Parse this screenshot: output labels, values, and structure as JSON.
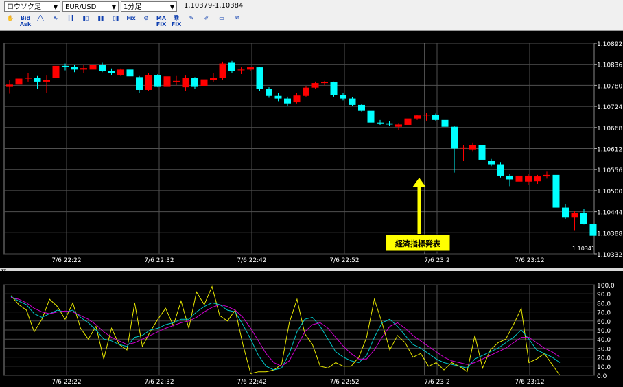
{
  "toolbar": {
    "chart_type": "ロウソク足",
    "pair": "EUR/USD",
    "timeframe": "1分足",
    "quote": "1.10379-1.10384",
    "icons": [
      {
        "name": "hand-icon",
        "glyph": "✋"
      },
      {
        "name": "bid-ask-icon",
        "glyph": "Bid Ask"
      },
      {
        "name": "line-chart-icon",
        "glyph": "╱╲"
      },
      {
        "name": "wave-chart-icon",
        "glyph": "∿"
      },
      {
        "name": "bar-chart-icon",
        "glyph": "┃┃"
      },
      {
        "name": "candlestick-icon",
        "glyph": "▮▯"
      },
      {
        "name": "candle-color-icon",
        "glyph": "▮▮"
      },
      {
        "name": "candle-alt-icon",
        "glyph": "▯▮"
      },
      {
        "name": "fix-icon",
        "glyph": "Fix"
      },
      {
        "name": "settings-fix-icon",
        "glyph": "⚙"
      },
      {
        "name": "ma-fix-icon",
        "glyph": "MA FIX"
      },
      {
        "name": "stochastic-fix-icon",
        "glyph": "乖 FIX"
      },
      {
        "name": "draw-line-icon",
        "glyph": "✎"
      },
      {
        "name": "erase-icon",
        "glyph": "✐"
      },
      {
        "name": "print-icon",
        "glyph": "▭"
      },
      {
        "name": "note-icon",
        "glyph": "✉"
      }
    ]
  },
  "chart_data": [
    {
      "type": "candlestick",
      "price_labels": [
        "1.10892",
        "1.10836",
        "1.10780",
        "1.10724",
        "1.10668",
        "1.10612",
        "1.10556",
        "1.10500",
        "1.10444",
        "1.10388",
        "1.10332"
      ],
      "current_price": "1.10341",
      "time_labels": [
        "7/6 22:22",
        "7/6 22:32",
        "7/6 22:42",
        "7/6 22:52",
        "7/6 23:2",
        "7/6 23:12"
      ],
      "ylim": [
        1.10332,
        1.10892
      ],
      "annotation": "経済指標発表",
      "colors": {
        "up": "#ff0000",
        "down": "#00ffff"
      },
      "candles": [
        [
          1.10776,
          1.10795,
          1.10758,
          1.10782
        ],
        [
          1.10782,
          1.10805,
          1.10772,
          1.10798
        ],
        [
          1.10798,
          1.10812,
          1.1079,
          1.108
        ],
        [
          1.108,
          1.10805,
          1.1077,
          1.1079
        ],
        [
          1.1079,
          1.10806,
          1.1076,
          1.10795
        ],
        [
          1.108,
          1.1084,
          1.10798,
          1.10832
        ],
        [
          1.10832,
          1.10838,
          1.1082,
          1.1083
        ],
        [
          1.1083,
          1.10835,
          1.10815,
          1.10822
        ],
        [
          1.10822,
          1.10835,
          1.10812,
          1.10826
        ],
        [
          1.10822,
          1.1084,
          1.1081,
          1.10835
        ],
        [
          1.10835,
          1.1084,
          1.10815,
          1.10818
        ],
        [
          1.10818,
          1.10825,
          1.10808,
          1.10812
        ],
        [
          1.10808,
          1.10825,
          1.10805,
          1.10822
        ],
        [
          1.10822,
          1.10825,
          1.108,
          1.10804
        ],
        [
          1.10802,
          1.10805,
          1.1076,
          1.10768
        ],
        [
          1.10768,
          1.10812,
          1.10766,
          1.10808
        ],
        [
          1.10808,
          1.1081,
          1.10775,
          1.10776
        ],
        [
          1.10776,
          1.10808,
          1.1077,
          1.10804
        ],
        [
          1.1079,
          1.10805,
          1.1078,
          1.10792
        ],
        [
          1.10775,
          1.10806,
          1.10765,
          1.108
        ],
        [
          1.108,
          1.10802,
          1.1077,
          1.10776
        ],
        [
          1.10778,
          1.108,
          1.10775,
          1.10796
        ],
        [
          1.10795,
          1.10812,
          1.1079,
          1.108
        ],
        [
          1.108,
          1.10843,
          1.10795,
          1.10838
        ],
        [
          1.1084,
          1.10845,
          1.10812,
          1.10818
        ],
        [
          1.1082,
          1.10828,
          1.1081,
          1.10822
        ],
        [
          1.10822,
          1.10828,
          1.10818,
          1.10828
        ],
        [
          1.10828,
          1.1083,
          1.10765,
          1.1077
        ],
        [
          1.1077,
          1.10775,
          1.10747,
          1.10752
        ],
        [
          1.10752,
          1.1076,
          1.10738,
          1.10745
        ],
        [
          1.10745,
          1.1075,
          1.10725,
          1.10732
        ],
        [
          1.10735,
          1.1076,
          1.10732,
          1.10753
        ],
        [
          1.10752,
          1.10778,
          1.1075,
          1.10774
        ],
        [
          1.10774,
          1.1079,
          1.1077,
          1.10786
        ],
        [
          1.10786,
          1.10792,
          1.1078,
          1.10788
        ],
        [
          1.10788,
          1.1079,
          1.1075,
          1.10755
        ],
        [
          1.10755,
          1.1076,
          1.1074,
          1.10745
        ],
        [
          1.10745,
          1.10748,
          1.10725,
          1.10728
        ],
        [
          1.10728,
          1.1073,
          1.1071,
          1.10712
        ],
        [
          1.10712,
          1.10715,
          1.10678,
          1.10681
        ],
        [
          1.10681,
          1.10688,
          1.10675,
          1.10679
        ],
        [
          1.10679,
          1.10684,
          1.10672,
          1.10676
        ],
        [
          1.1067,
          1.1068,
          1.10662,
          1.10676
        ],
        [
          1.10675,
          1.10695,
          1.10672,
          1.10692
        ],
        [
          1.10692,
          1.10702,
          1.10688,
          1.107
        ],
        [
          1.107,
          1.10706,
          1.10686,
          1.10702
        ],
        [
          1.10702,
          1.10705,
          1.10686,
          1.10688
        ],
        [
          1.10688,
          1.10692,
          1.10668,
          1.1067
        ],
        [
          1.1067,
          1.10672,
          1.10548,
          1.10612
        ],
        [
          1.10612,
          1.10622,
          1.1058,
          1.10615
        ],
        [
          1.1061,
          1.10628,
          1.10605,
          1.10622
        ],
        [
          1.10622,
          1.1063,
          1.10578,
          1.10582
        ],
        [
          1.1058,
          1.10586,
          1.10565,
          1.1057
        ],
        [
          1.1057,
          1.10576,
          1.10535,
          1.1054
        ],
        [
          1.1054,
          1.10545,
          1.10512,
          1.1053
        ],
        [
          1.10524,
          1.1054,
          1.10508,
          1.1054
        ],
        [
          1.10524,
          1.10545,
          1.10515,
          1.1054
        ],
        [
          1.10525,
          1.10542,
          1.10518,
          1.10538
        ],
        [
          1.10538,
          1.10552,
          1.10532,
          1.10542
        ],
        [
          1.10542,
          1.10545,
          1.1045,
          1.10455
        ],
        [
          1.10455,
          1.10465,
          1.10425,
          1.1043
        ],
        [
          1.1043,
          1.10445,
          1.10395,
          1.1044
        ],
        [
          1.1044,
          1.10452,
          1.1041,
          1.10412
        ],
        [
          1.10412,
          1.10418,
          1.10376,
          1.1038
        ]
      ]
    },
    {
      "type": "line",
      "y_labels": [
        "100.0",
        "90.0",
        "80.0",
        "70.0",
        "60.0",
        "50.0",
        "40.0",
        "30.0",
        "20.0",
        "10.0",
        "0.0"
      ],
      "ylim": [
        0,
        100
      ],
      "time_labels": [
        "7/6 22:22",
        "7/6 22:32",
        "7/6 22:42",
        "7/6 22:52",
        "7/6 23:2",
        "7/6 23:12"
      ],
      "series": [
        {
          "color": "#e8e800",
          "values": [
            88,
            78,
            72,
            48,
            62,
            84,
            76,
            62,
            80,
            52,
            40,
            54,
            18,
            52,
            34,
            28,
            80,
            32,
            48,
            62,
            74,
            55,
            82,
            52,
            92,
            78,
            98,
            66,
            60,
            72,
            34,
            2,
            4,
            4,
            6,
            12,
            58,
            84,
            46,
            34,
            10,
            8,
            14,
            10,
            10,
            20,
            42,
            84,
            58,
            28,
            44,
            36,
            20,
            24,
            10,
            14,
            6,
            14,
            10,
            4,
            44,
            8,
            28,
            36,
            40,
            56,
            74,
            14,
            18,
            24,
            12,
            0
          ]
        },
        {
          "color": "#00c8c8",
          "values": [
            87,
            82,
            78,
            68,
            64,
            68,
            72,
            70,
            72,
            64,
            58,
            50,
            40,
            38,
            34,
            32,
            42,
            44,
            50,
            52,
            56,
            58,
            62,
            62,
            70,
            76,
            80,
            78,
            72,
            70,
            56,
            40,
            22,
            10,
            6,
            8,
            24,
            48,
            62,
            64,
            54,
            40,
            26,
            20,
            16,
            14,
            22,
            42,
            58,
            62,
            54,
            44,
            34,
            30,
            24,
            18,
            14,
            12,
            10,
            8,
            18,
            22,
            26,
            30,
            36,
            42,
            50,
            40,
            28,
            24,
            20,
            14
          ]
        },
        {
          "color": "#d000d0",
          "values": [
            86,
            84,
            80,
            74,
            70,
            68,
            70,
            71,
            70,
            66,
            62,
            56,
            48,
            42,
            38,
            34,
            36,
            40,
            44,
            48,
            52,
            55,
            58,
            60,
            64,
            70,
            75,
            78,
            76,
            72,
            64,
            52,
            38,
            24,
            14,
            10,
            16,
            32,
            48,
            56,
            58,
            52,
            42,
            32,
            24,
            18,
            18,
            28,
            42,
            54,
            58,
            52,
            44,
            38,
            32,
            26,
            20,
            16,
            14,
            12,
            14,
            18,
            22,
            26,
            30,
            36,
            42,
            42,
            36,
            30,
            26,
            20
          ]
        }
      ]
    }
  ]
}
